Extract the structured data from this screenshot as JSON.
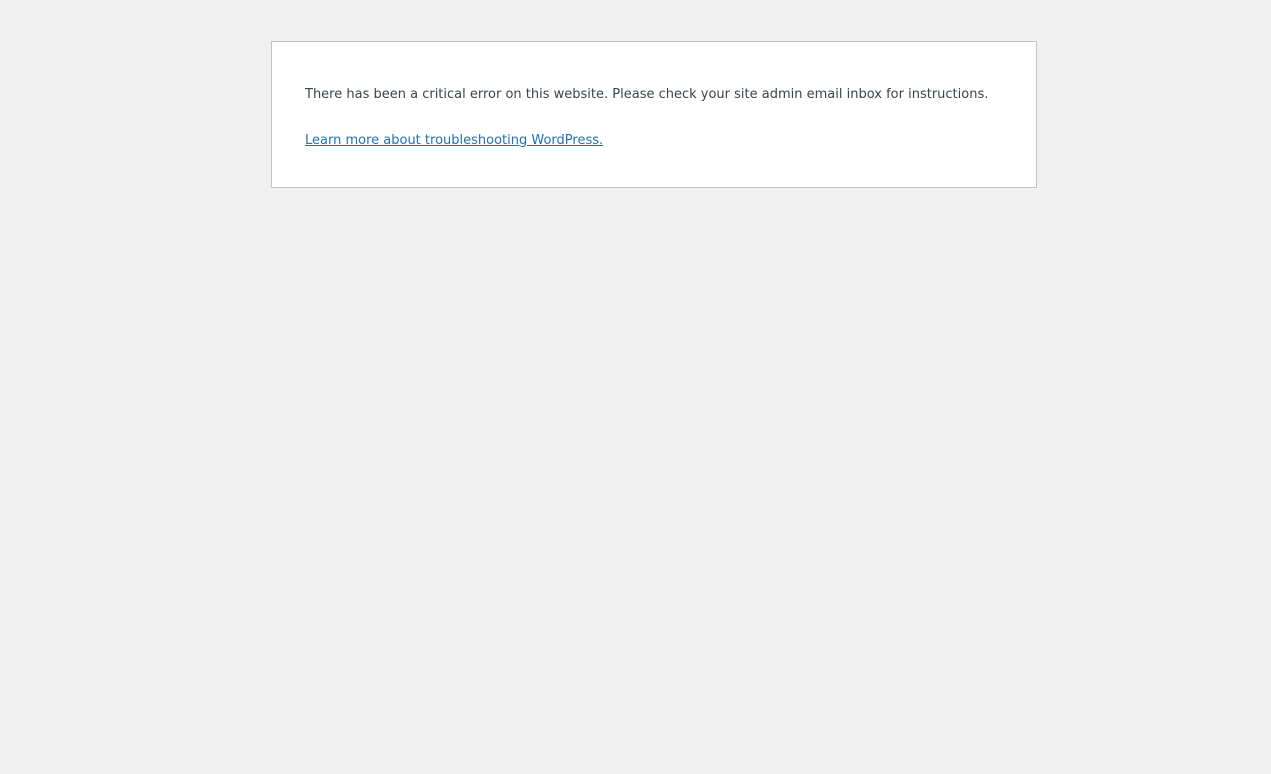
{
  "error": {
    "message": "There has been a critical error on this website. Please check your site admin email inbox for instructions.",
    "link_label": "Learn more about troubleshooting WordPress."
  },
  "colors": {
    "background": "#f0f0f1",
    "panel": "#ffffff",
    "border": "#c3c4c7",
    "text": "#3c434a",
    "link": "#2271b1"
  }
}
